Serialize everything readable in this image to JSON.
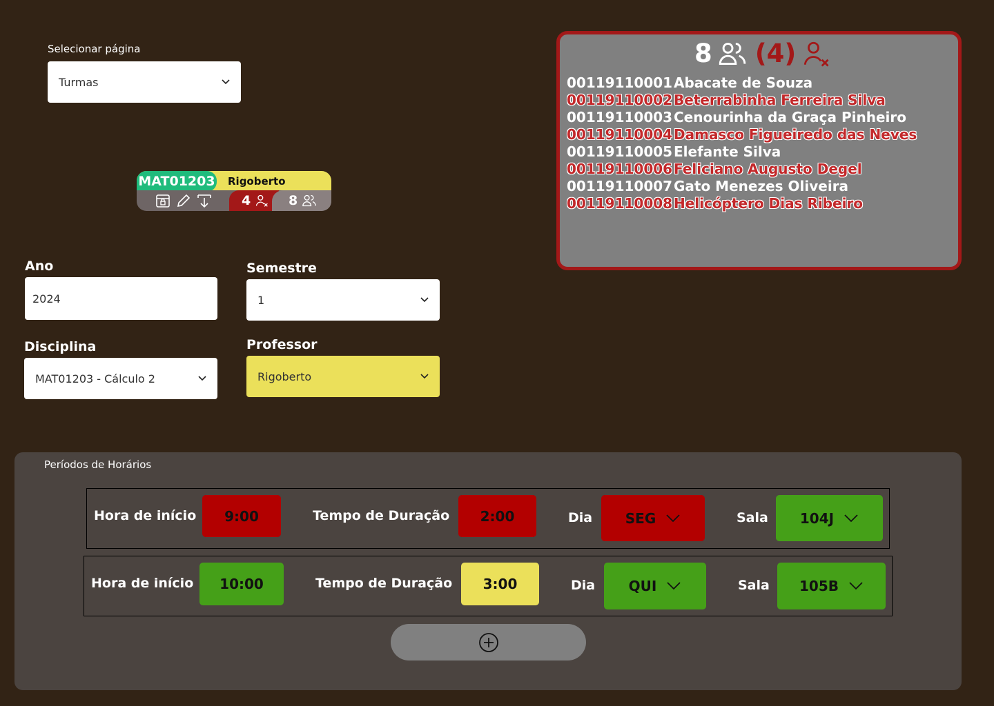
{
  "page_select": {
    "label": "Selecionar página",
    "value": "Turmas"
  },
  "class_card": {
    "code": "MAT01203",
    "professor": "Rigoberto",
    "failing_count": "4",
    "student_count": "8",
    "colors": {
      "code_bg": "#1fbb7c",
      "prof_bg": "#ebe05a",
      "fail_bg": "#a31818"
    }
  },
  "panel": {
    "total": "8",
    "failing": "(4)",
    "students": [
      {
        "id": "00119110001",
        "name": "Abacate de Souza",
        "failing": false
      },
      {
        "id": "00119110002",
        "name": "Beterrabinha Ferreira Silva",
        "failing": true
      },
      {
        "id": "00119110003",
        "name": "Cenourinha da Graça Pinheiro",
        "failing": false
      },
      {
        "id": "00119110004",
        "name": "Damasco Figueiredo das Neves",
        "failing": true
      },
      {
        "id": "00119110005",
        "name": "Elefante Silva",
        "failing": false
      },
      {
        "id": "00119110006",
        "name": "Feliciano Augusto Degel",
        "failing": true
      },
      {
        "id": "00119110007",
        "name": "Gato Menezes Oliveira",
        "failing": false
      },
      {
        "id": "00119110008",
        "name": "Helicóptero Dias Ribeiro",
        "failing": true
      }
    ]
  },
  "form": {
    "ano": {
      "label": "Ano",
      "value": "2024"
    },
    "semestre": {
      "label": "Semestre",
      "value": "1"
    },
    "disciplina": {
      "label": "Disciplina",
      "value": "MAT01203 - Cálculo 2"
    },
    "professor": {
      "label": "Professor",
      "value": "Rigoberto"
    }
  },
  "periods": {
    "title": "Períodos de Horários",
    "labels": {
      "start": "Hora de início",
      "duration": "Tempo de Duração",
      "day": "Dia",
      "room": "Sala"
    },
    "rows": [
      {
        "start": "9:00",
        "duration": "2:00",
        "day": "SEG",
        "room": "104J"
      },
      {
        "start": "10:00",
        "duration": "3:00",
        "day": "QUI",
        "room": "105B"
      }
    ]
  }
}
